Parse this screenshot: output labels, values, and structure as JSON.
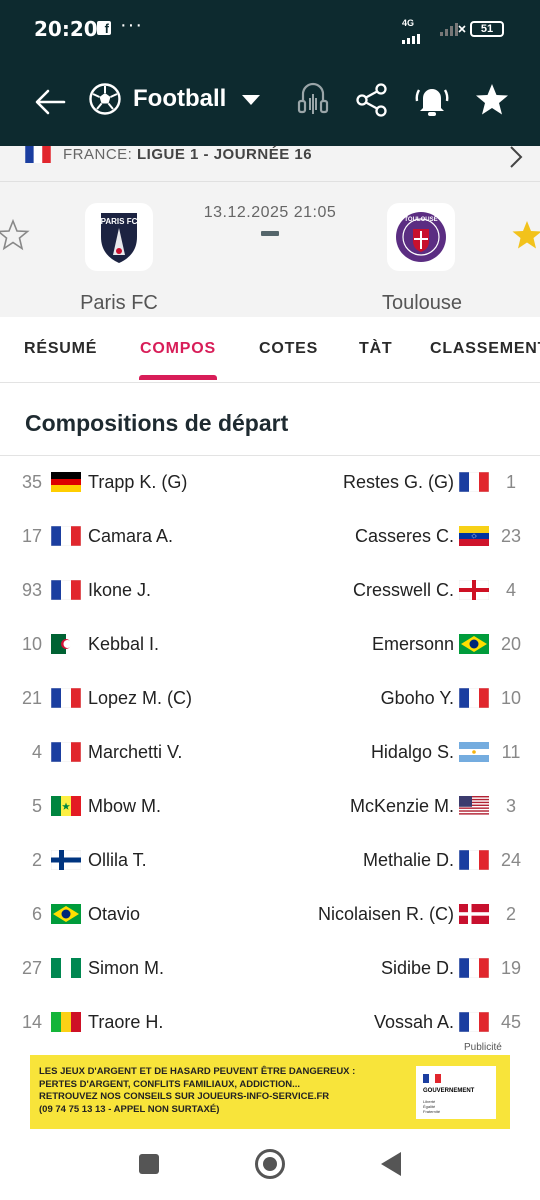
{
  "status_bar": {
    "time": "20:20",
    "dots": "···",
    "network": "4G",
    "battery": "51"
  },
  "app_bar": {
    "title": "Football"
  },
  "league": {
    "country": "FRANCE:",
    "competition": "LIGUE 1 - JOURNÉE 16"
  },
  "match": {
    "datetime": "13.12.2025 21:05",
    "home": {
      "name": "Paris FC",
      "logo_text": "PARIS FC",
      "favorite": false
    },
    "away": {
      "name": "Toulouse",
      "logo_text": "TOULOUSE",
      "favorite": true
    }
  },
  "tabs": [
    {
      "label": "RÉSUMÉ",
      "active": false
    },
    {
      "label": "COMPOS",
      "active": true
    },
    {
      "label": "COTES",
      "active": false
    },
    {
      "label": "TÀT",
      "active": false
    },
    {
      "label": "CLASSEMENT",
      "active": false
    }
  ],
  "section_title": "Compositions de départ",
  "lineup": [
    {
      "home": {
        "number": "35",
        "name": "Trapp K. (G)",
        "flag": "germany"
      },
      "away": {
        "number": "1",
        "name": "Restes G. (G)",
        "flag": "france"
      }
    },
    {
      "home": {
        "number": "17",
        "name": "Camara A.",
        "flag": "france"
      },
      "away": {
        "number": "23",
        "name": "Casseres C.",
        "flag": "venezuela"
      }
    },
    {
      "home": {
        "number": "93",
        "name": "Ikone J.",
        "flag": "france"
      },
      "away": {
        "number": "4",
        "name": "Cresswell C.",
        "flag": "england"
      }
    },
    {
      "home": {
        "number": "10",
        "name": "Kebbal I.",
        "flag": "algeria"
      },
      "away": {
        "number": "20",
        "name": "Emersonn",
        "flag": "brazil"
      }
    },
    {
      "home": {
        "number": "21",
        "name": "Lopez M. (C)",
        "flag": "france"
      },
      "away": {
        "number": "10",
        "name": "Gboho Y.",
        "flag": "france"
      }
    },
    {
      "home": {
        "number": "4",
        "name": "Marchetti V.",
        "flag": "france"
      },
      "away": {
        "number": "11",
        "name": "Hidalgo S.",
        "flag": "argentina"
      }
    },
    {
      "home": {
        "number": "5",
        "name": "Mbow M.",
        "flag": "senegal"
      },
      "away": {
        "number": "3",
        "name": "McKenzie M.",
        "flag": "usa"
      }
    },
    {
      "home": {
        "number": "2",
        "name": "Ollila T.",
        "flag": "finland"
      },
      "away": {
        "number": "24",
        "name": "Methalie D.",
        "flag": "france"
      }
    },
    {
      "home": {
        "number": "6",
        "name": "Otavio",
        "flag": "brazil"
      },
      "away": {
        "number": "2",
        "name": "Nicolaisen R. (C)",
        "flag": "denmark"
      }
    },
    {
      "home": {
        "number": "27",
        "name": "Simon M.",
        "flag": "nigeria"
      },
      "away": {
        "number": "19",
        "name": "Sidibe D.",
        "flag": "france"
      }
    },
    {
      "home": {
        "number": "14",
        "name": "Traore H.",
        "flag": "mali"
      },
      "away": {
        "number": "45",
        "name": "Vossah A.",
        "flag": "france"
      }
    }
  ],
  "ad": {
    "label": "Publicité",
    "lines": [
      "LES JEUX D'ARGENT ET DE HASARD PEUVENT ÊTRE DANGEREUX :",
      "PERTES D'ARGENT, CONFLITS FAMILIAUX, ADDICTION...",
      "RETROUVEZ NOS CONSEILS SUR JOUEURS-INFO-SERVICE.FR",
      "(09 74 75 13 13 - APPEL NON SURTAXÉ)"
    ],
    "gov_name": "GOUVERNEMENT",
    "gov_motto": "Liberté\nÉgalité\nFraternité"
  },
  "colors": {
    "header_bg": "#0d2a2f",
    "accent": "#d81d58",
    "star_active": "#f2c21b",
    "ad_bg": "#f8e43a"
  }
}
